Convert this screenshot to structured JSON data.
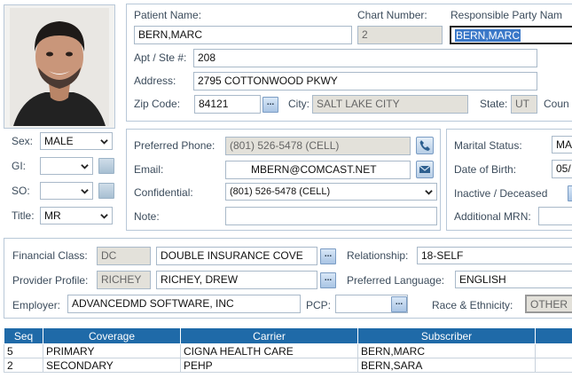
{
  "left": {
    "sex": {
      "label": "Sex:",
      "value": "MALE"
    },
    "gi": {
      "label": "GI:",
      "value": ""
    },
    "so": {
      "label": "SO:",
      "value": ""
    },
    "title": {
      "label": "Title:",
      "value": "MR"
    }
  },
  "patient": {
    "name_label": "Patient Name:",
    "name_value": "BERN,MARC",
    "chart_label": "Chart Number:",
    "chart_value": "2",
    "resp_label": "Responsible Party Nam",
    "resp_value": "BERN,MARC",
    "apt_label": "Apt / Ste #:",
    "apt_value": "208",
    "address_label": "Address:",
    "address_value": "2795 COTTONWOOD PKWY",
    "zip_label": "Zip Code:",
    "zip_value": "84121",
    "city_label": "City:",
    "city_value": "SALT LAKE CITY",
    "state_label": "State:",
    "state_value": "UT",
    "county_label": "Coun"
  },
  "contact": {
    "phone_label": "Preferred Phone:",
    "phone_value": "(801) 526-5478 (CELL)",
    "email_label": "Email:",
    "email_value": "MBERN@COMCAST.NET",
    "confidential_label": "Confidential:",
    "confidential_value": "(801) 526-5478 (CELL)",
    "note_label": "Note:",
    "note_value": ""
  },
  "status": {
    "marital_label": "Marital Status:",
    "marital_value": "MA",
    "dob_label": "Date of Birth:",
    "dob_value": "05/",
    "inactive_label": "Inactive / Deceased",
    "mrn_label": "Additional MRN:",
    "mrn_value": ""
  },
  "financial": {
    "class_label": "Financial Class:",
    "class_code": "DC",
    "class_value": "DOUBLE INSURANCE COVE",
    "relationship_label": "Relationship:",
    "relationship_value": "18-SELF",
    "provider_label": "Provider Profile:",
    "provider_code": "RICHEY",
    "provider_value": "RICHEY, DREW",
    "language_label": "Preferred Language:",
    "language_value": "ENGLISH",
    "employer_label": "Employer:",
    "employer_value": "ADVANCEDMD SOFTWARE, INC",
    "pcp_label": "PCP:",
    "pcp_value": "",
    "race_label": "Race & Ethnicity:",
    "race_value": "OTHER"
  },
  "coverage": {
    "headers": [
      "Seq",
      "Coverage",
      "Carrier",
      "Subscriber"
    ],
    "rows": [
      [
        "5",
        "PRIMARY",
        "CIGNA HEALTH CARE",
        "BERN,MARC"
      ],
      [
        "2",
        "SECONDARY",
        "PEHP",
        "BERN,SARA"
      ]
    ]
  },
  "button_text": "..."
}
